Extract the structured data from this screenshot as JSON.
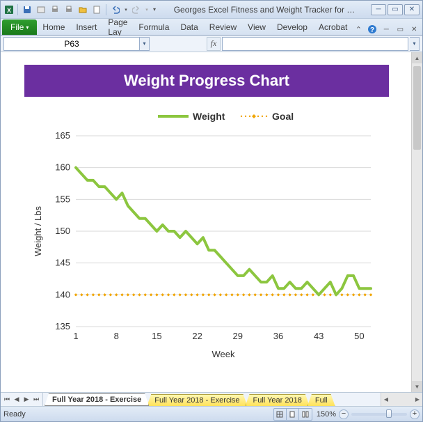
{
  "window": {
    "title": "Georges Excel Fitness and Weight Tracker for …"
  },
  "ribbon": {
    "file": "File",
    "tabs": [
      "Home",
      "Insert",
      "Page Lay",
      "Formula",
      "Data",
      "Review",
      "View",
      "Develop",
      "Acrobat"
    ]
  },
  "formula_bar": {
    "namebox": "P63",
    "fx": "fx",
    "formula": ""
  },
  "chart_title": "Weight Progress Chart",
  "chart_data": {
    "type": "line",
    "title": "Weight Progress Chart",
    "xlabel": "Week",
    "ylabel": "Weight / Lbs",
    "xlim": [
      1,
      52
    ],
    "ylim": [
      135,
      165
    ],
    "xticks": [
      1,
      8,
      15,
      22,
      29,
      36,
      43,
      50
    ],
    "yticks": [
      135,
      140,
      145,
      150,
      155,
      160,
      165
    ],
    "series": [
      {
        "name": "Weight",
        "color": "#8cc63f",
        "style": "line",
        "x": [
          1,
          2,
          3,
          4,
          5,
          6,
          7,
          8,
          9,
          10,
          11,
          12,
          13,
          14,
          15,
          16,
          17,
          18,
          19,
          20,
          21,
          22,
          23,
          24,
          25,
          26,
          27,
          28,
          29,
          30,
          31,
          32,
          33,
          34,
          35,
          36,
          37,
          38,
          39,
          40,
          41,
          42,
          43,
          44,
          45,
          46,
          47,
          48,
          49,
          50,
          51,
          52
        ],
        "values": [
          160,
          159,
          158,
          158,
          157,
          157,
          156,
          155,
          156,
          154,
          153,
          152,
          152,
          151,
          150,
          151,
          150,
          150,
          149,
          150,
          149,
          148,
          149,
          147,
          147,
          146,
          145,
          144,
          143,
          143,
          144,
          143,
          142,
          142,
          143,
          141,
          141,
          142,
          141,
          141,
          142,
          141,
          140,
          141,
          142,
          140,
          141,
          143,
          143,
          141,
          141,
          141
        ]
      },
      {
        "name": "Goal",
        "color": "#f0a500",
        "style": "dotted-markers",
        "x": [
          1,
          52
        ],
        "values": [
          140,
          140
        ]
      }
    ],
    "legend": [
      "Weight",
      "Goal"
    ]
  },
  "sheet_tabs": {
    "active": "Full Year 2018 - Exercise",
    "items": [
      "Full Year 2018 - Exercise",
      "Full Year 2018 - Exercise",
      "Full Year 2018",
      "Full"
    ]
  },
  "status": {
    "ready": "Ready",
    "zoom": "150%"
  }
}
